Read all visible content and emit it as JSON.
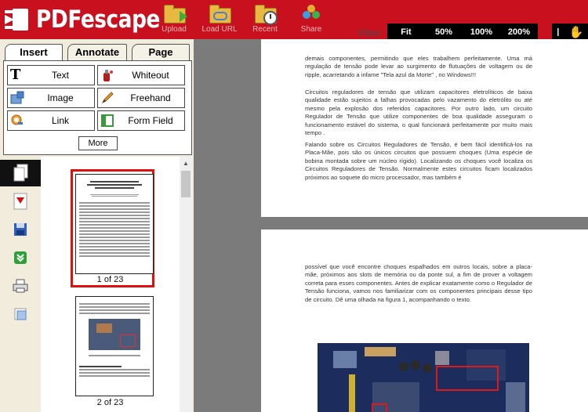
{
  "app": {
    "name": "PDFescape"
  },
  "toolbar": {
    "upload": "Upload",
    "load_url": "Load URL",
    "recent": "Recent",
    "share": "Share"
  },
  "view": {
    "label": "View:",
    "zoom_options": [
      "Fit",
      "50%",
      "100%",
      "200%"
    ]
  },
  "tabs": [
    "Insert",
    "Annotate",
    "Page"
  ],
  "insert_tools": [
    {
      "label": "Text",
      "icon": "text-icon"
    },
    {
      "label": "Whiteout",
      "icon": "whiteout-icon"
    },
    {
      "label": "Image",
      "icon": "image-icon"
    },
    {
      "label": "Freehand",
      "icon": "pencil-icon"
    },
    {
      "label": "Link",
      "icon": "link-icon"
    },
    {
      "label": "Form Field",
      "icon": "form-field-icon"
    }
  ],
  "more_label": "More",
  "side_icons": [
    "pages-icon",
    "pdf-icon",
    "save-icon",
    "download-icon",
    "print-icon",
    "page-frame-icon"
  ],
  "thumbnails": [
    {
      "label": "1 of 23",
      "selected": true
    },
    {
      "label": "2 of 23",
      "selected": false
    }
  ],
  "document": {
    "page1_paragraphs": [
      "demais componentes, permitindo que eles trabalhem perfeitamente. Uma má regulação de tensão pode levar ao surgimento de flutuações de voltagem ou de ripple, acarretando a infame \"Tela azul da Morte\" , no Windows!!!",
      "Circuitos reguladores de tensão que utilizam capacitores eletrolíticos de baixa qualidade estão sujeitos a falhas provocadas pelo vazamento do eletrólito ou até mesmo pela explosão dos referidos capacitores. Por outro lado, um circuito Regulador de Tensão que utilize componentes de boa qualidade asseguram o funcionamento estável do sistema, o qual funcionará perfeitamente por muito mais tempo .",
      "Falando sobre os Circuitos Reguladores de Tensão, é bem fácil identificá-los na Placa-Mãe, pois são os únicos circuitos que possuem choques (Uma espécie de bobina montada sobre um núcleo rígido). Localizando os choques você localiza os Circuitos Reguladores de Tensão. Normalmente estes circuitos ficam localizados próximos ao soquete do micro processador, mas também é"
    ],
    "page2_paragraphs": [
      "possível que você encontre choques espalhados em outros locais, sobre a placa-mãe, próximos aos slots de memória ou da ponte sul, a fim de prover a voltagem correta para esses componentes. Antes de explicar exatamente como o Regulador de Tensão funciona, vamos nos familiarizar com os componentes principais desse tipo de circuito. Dê uma olhada na figura 1, acompanhando o texto."
    ]
  },
  "colors": {
    "brand_red": "#c8101e",
    "selection_red": "#e01010",
    "panel_beige": "#f1ecdc"
  }
}
